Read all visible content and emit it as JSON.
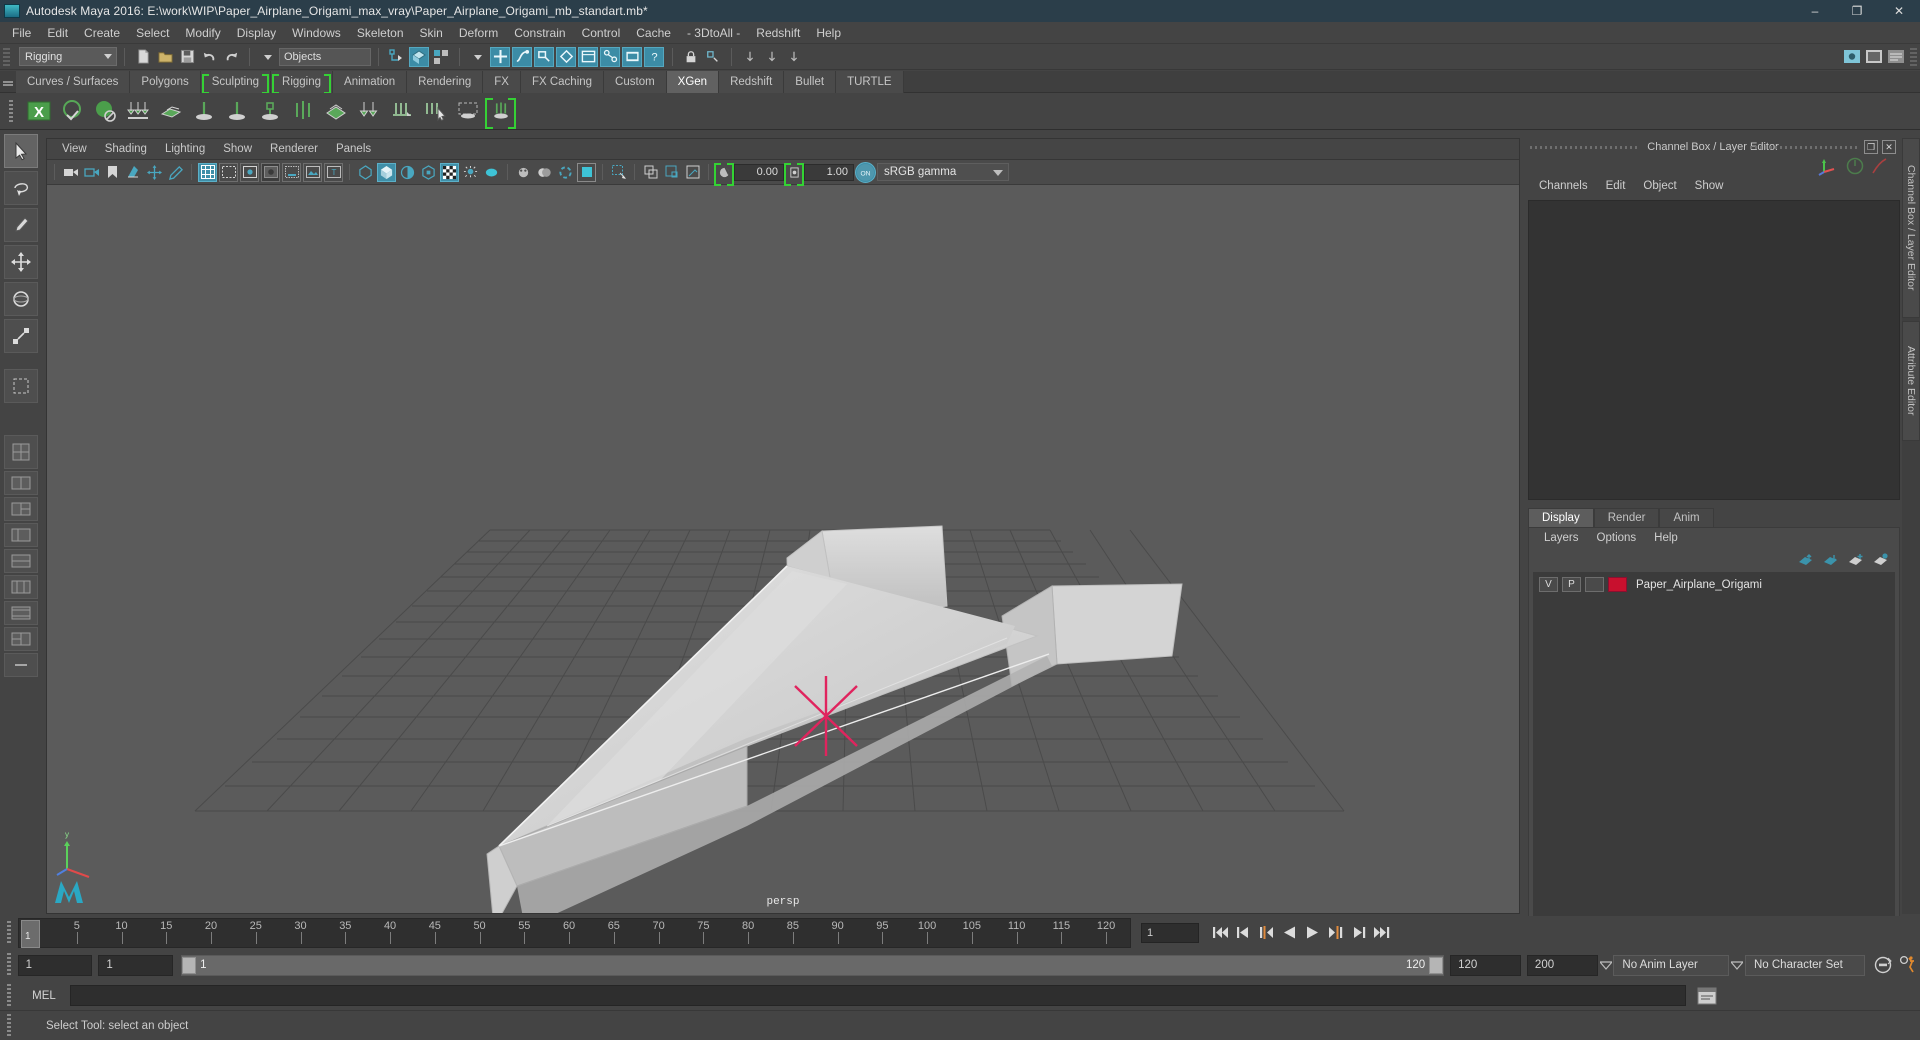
{
  "window": {
    "title": "Autodesk Maya 2016: E:\\work\\WIP\\Paper_Airplane_Origami_max_vray\\Paper_Airplane_Origami_mb_standart.mb*",
    "minimize": "–",
    "maximize": "❐",
    "close": "✕"
  },
  "menubar": {
    "items": [
      "File",
      "Edit",
      "Create",
      "Select",
      "Modify",
      "Display",
      "Windows",
      "Skeleton",
      "Skin",
      "Deform",
      "Constrain",
      "Control",
      "Cache",
      "- 3DtoAll -",
      "Redshift",
      "Help"
    ]
  },
  "statusbar": {
    "menuset": "Rigging",
    "object_field": "Objects"
  },
  "shelf": {
    "tabs": [
      {
        "label": "Curves / Surfaces",
        "state": "normal"
      },
      {
        "label": "Polygons",
        "state": "normal"
      },
      {
        "label": "Sculpting",
        "state": "bracket"
      },
      {
        "label": "Rigging",
        "state": "bracket"
      },
      {
        "label": "Animation",
        "state": "normal"
      },
      {
        "label": "Rendering",
        "state": "normal"
      },
      {
        "label": "FX",
        "state": "normal"
      },
      {
        "label": "FX Caching",
        "state": "normal"
      },
      {
        "label": "Custom",
        "state": "normal"
      },
      {
        "label": "XGen",
        "state": "active"
      },
      {
        "label": "Redshift",
        "state": "normal"
      },
      {
        "label": "Bullet",
        "state": "normal"
      },
      {
        "label": "TURTLE",
        "state": "normal"
      }
    ]
  },
  "viewport": {
    "menus": [
      "View",
      "Shading",
      "Lighting",
      "Show",
      "Renderer",
      "Panels"
    ],
    "exposure": "0.00",
    "gamma": "1.00",
    "color_profile": "sRGB gamma",
    "camera_label": "persp"
  },
  "right_dock": {
    "title": "Channel Box / Layer Editor",
    "restore_icon": "❐",
    "close_icon": "✕",
    "channel_menus": [
      "Channels",
      "Edit",
      "Object",
      "Show"
    ],
    "layer_tabs": [
      {
        "label": "Display",
        "active": true
      },
      {
        "label": "Render",
        "active": false
      },
      {
        "label": "Anim",
        "active": false
      }
    ],
    "layer_menus": [
      "Layers",
      "Options",
      "Help"
    ],
    "layers": [
      {
        "visible": "V",
        "playback": "P",
        "type": "",
        "color": "#c8102e",
        "name": "Paper_Airplane_Origami"
      }
    ],
    "vertical_tabs": [
      "Channel Box / Layer Editor",
      "Attribute Editor"
    ]
  },
  "timeline": {
    "ticks": [
      5,
      10,
      15,
      20,
      25,
      30,
      35,
      40,
      45,
      50,
      55,
      60,
      65,
      70,
      75,
      80,
      85,
      90,
      95,
      100,
      105,
      110,
      115,
      120
    ],
    "current_frame": "1",
    "playhead_label": "1",
    "transport": [
      "go-to-start",
      "step-back-key",
      "step-back-frame",
      "play-backwards",
      "play-forwards",
      "step-forward-frame",
      "step-forward-key",
      "go-to-end"
    ]
  },
  "range": {
    "start": "1",
    "end": "1",
    "slider_start_label": "1",
    "slider_end_label": "120",
    "playback_end": "120",
    "anim_end": "200",
    "anim_layer": "No Anim Layer",
    "character_set": "No Character Set"
  },
  "command": {
    "label": "MEL",
    "input_value": ""
  },
  "status": {
    "message": "Select Tool: select an object"
  }
}
